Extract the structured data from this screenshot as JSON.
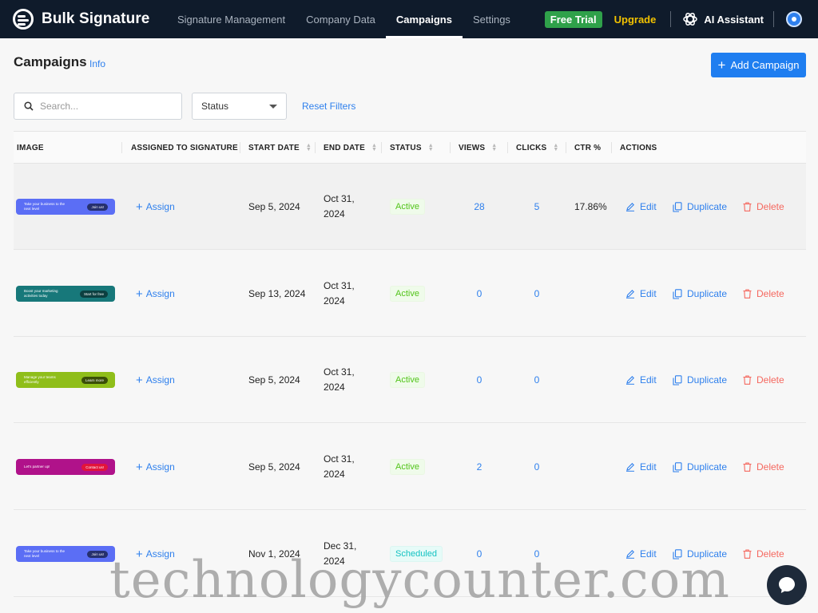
{
  "app": {
    "name": "Bulk Signature"
  },
  "nav": {
    "tabs": [
      "Signature Management",
      "Company Data",
      "Campaigns",
      "Settings"
    ],
    "active_tab": "Campaigns",
    "free_trial": "Free Trial",
    "upgrade": "Upgrade",
    "ai_assistant": "AI Assistant"
  },
  "header": {
    "title": "Campaigns",
    "info": "Info",
    "add_button": "Add Campaign"
  },
  "filters": {
    "search_placeholder": "Search...",
    "status": "Status",
    "reset": "Reset Filters"
  },
  "table": {
    "columns": [
      "IMAGE",
      "ASSIGNED TO SIGNATURE",
      "START DATE",
      "END DATE",
      "STATUS",
      "VIEWS",
      "CLICKS",
      "CTR %",
      "ACTIONS"
    ],
    "rows": [
      {
        "banner": {
          "text": "Take your business to the next level",
          "button": "Join us!",
          "bg": "#5b6ef5",
          "btn_bg": "#26306e"
        },
        "assign": "Assign",
        "start_date": "Sep 5, 2024",
        "end_date_line1": "Oct 31,",
        "end_date_line2": "2024",
        "status": "Active",
        "views": "28",
        "clicks": "5",
        "ctr": "17.86%",
        "edit": "Edit",
        "duplicate": "Duplicate",
        "delete": "Delete"
      },
      {
        "banner": {
          "text": "Boost your marketing activities today",
          "button": "Start for free",
          "bg": "#17787a",
          "btn_bg": "#0c3f40"
        },
        "assign": "Assign",
        "start_date": "Sep 13, 2024",
        "end_date_line1": "Oct 31,",
        "end_date_line2": "2024",
        "status": "Active",
        "views": "0",
        "clicks": "0",
        "ctr": "",
        "edit": "Edit",
        "duplicate": "Duplicate",
        "delete": "Delete"
      },
      {
        "banner": {
          "text": "Manage your teams efficiently",
          "button": "Learn more",
          "bg": "#8fbe1a",
          "btn_bg": "#3a4f08"
        },
        "assign": "Assign",
        "start_date": "Sep 5, 2024",
        "end_date_line1": "Oct 31,",
        "end_date_line2": "2024",
        "status": "Active",
        "views": "0",
        "clicks": "0",
        "ctr": "",
        "edit": "Edit",
        "duplicate": "Duplicate",
        "delete": "Delete"
      },
      {
        "banner": {
          "text": "Let's partner up!",
          "button": "Contact us!",
          "bg": "#b0128a",
          "btn_bg": "#e2143a"
        },
        "assign": "Assign",
        "start_date": "Sep 5, 2024",
        "end_date_line1": "Oct 31,",
        "end_date_line2": "2024",
        "status": "Active",
        "views": "2",
        "clicks": "0",
        "ctr": "",
        "edit": "Edit",
        "duplicate": "Duplicate",
        "delete": "Delete"
      },
      {
        "banner": {
          "text": "Take your business to the next level",
          "button": "Join us!",
          "bg": "#5b6ef5",
          "btn_bg": "#26306e"
        },
        "assign": "Assign",
        "start_date": "Nov 1, 2024",
        "end_date_line1": "Dec 31,",
        "end_date_line2": "2024",
        "status": "Scheduled",
        "views": "0",
        "clicks": "0",
        "ctr": "",
        "edit": "Edit",
        "duplicate": "Duplicate",
        "delete": "Delete"
      }
    ]
  },
  "watermark": "technologycounter.com",
  "colors": {
    "nav_bg": "#0f1b2b",
    "accent": "#1f7ef0",
    "active_green": "#52c41a",
    "scheduled_teal": "#13c2c2",
    "delete_red": "#f5685f"
  },
  "icons": [
    "logo-icon",
    "openai-icon",
    "profile-icon",
    "plus-icon",
    "search-icon",
    "caret-down-icon",
    "sort-icon",
    "edit-icon",
    "copy-icon",
    "trash-icon",
    "chat-icon"
  ]
}
